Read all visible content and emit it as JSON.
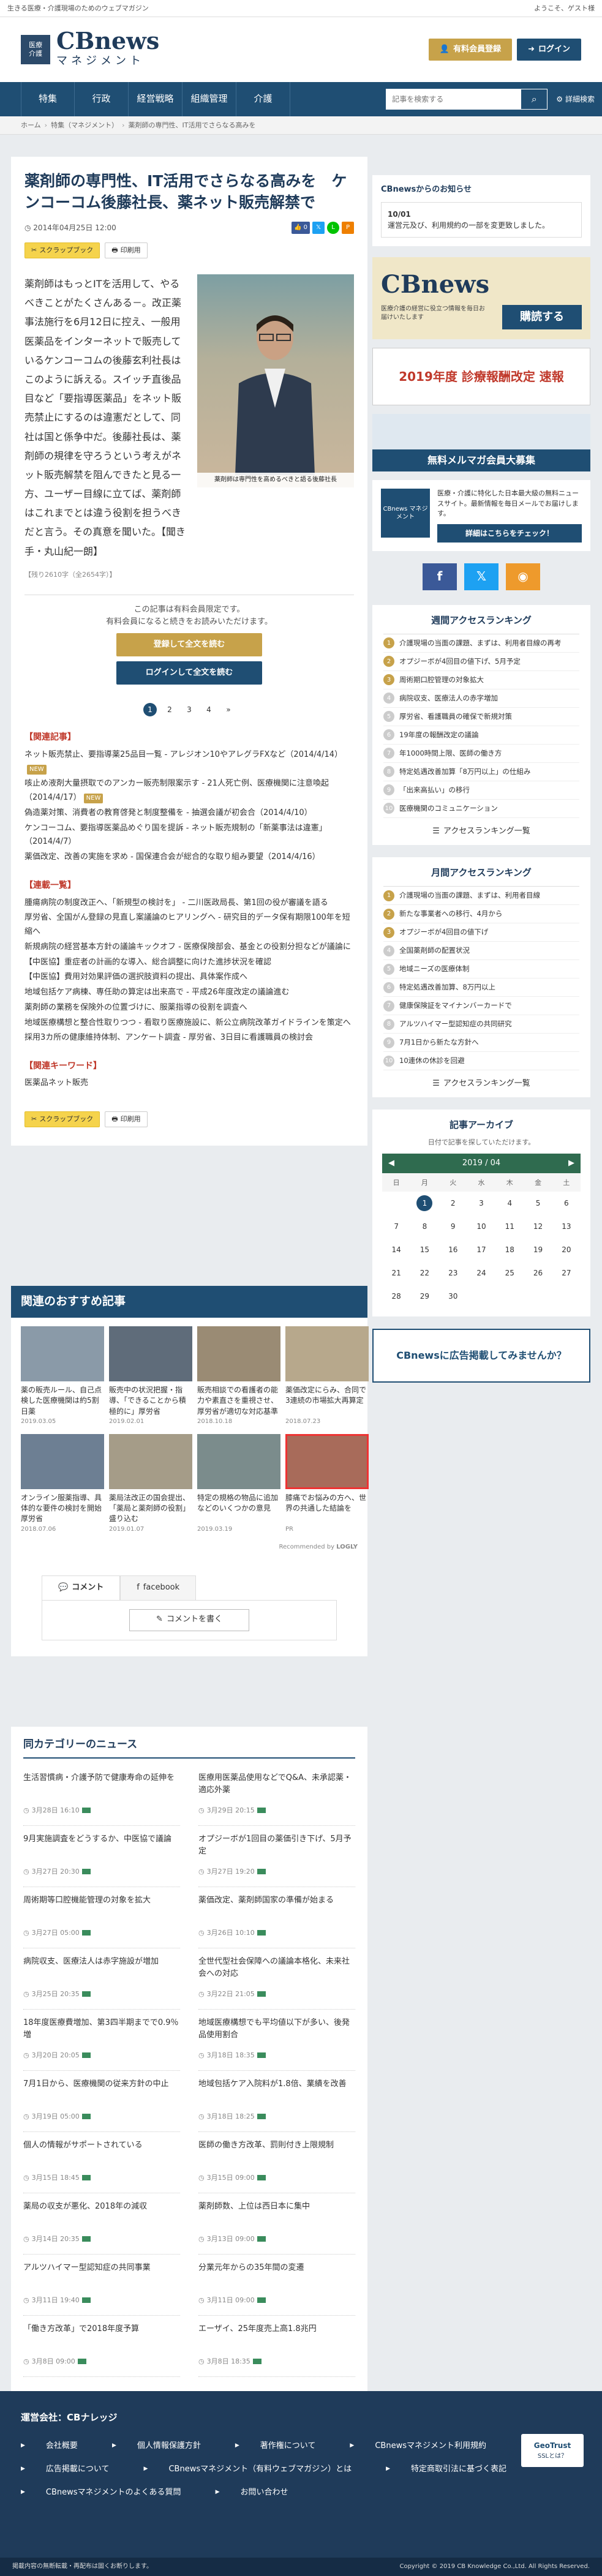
{
  "browser": {
    "url": "https://www.cbnews.jp/news/entry/42540",
    "tagline": "生きる医療・介護現場のためのウェブマガジン",
    "welcome": "ようこそ、ゲスト様"
  },
  "header": {
    "logo_badge_top": "医療",
    "logo_badge_bottom": "介護",
    "logo_name": "CBnews",
    "logo_sub": "マネジメント",
    "register_label": "有料会員登録",
    "login_label": "ログイン"
  },
  "nav": {
    "items": [
      "特集",
      "行政",
      "経営戦略",
      "組織管理",
      "介護"
    ],
    "search_placeholder": "記事を検索する",
    "advanced_label": "詳細検索"
  },
  "breadcrumb": [
    "ホーム",
    "特集（マネジメント）",
    "薬剤師の専門性、IT活用でさらなる高みを"
  ],
  "article": {
    "title": "薬剤師の専門性、IT活用でさらなる高みを　ケンコーコム後藤社長、薬ネット販売解禁で",
    "date": "2014年04月25日 12:00",
    "scrap_label": "スクラップブック",
    "print_label": "印刷用",
    "body": "薬剤師はもっとITを活用して、やるべきことがたくさんある－。改正薬事法施行を6月12日に控え、一般用医薬品をインターネットで販売しているケンコーコムの後藤玄利社長はこのように訴える。スイッチ直後品目など「要指導医薬品」をネット販売禁止にするのは違憲だとして、同社は国と係争中だ。後藤社長は、薬剤師の規律を守ろうという考えがネット販売解禁を阻んできたと見る一方、ユーザー目線に立てば、薬剤師はこれまでとは違う役割を担うべきだと言う。その真意を聞いた。【聞き手・丸山紀一朗】",
    "photo_caption": "薬剤師は専門性を高めるべきと語る後藤社長",
    "counts_note": "【残り2610字（全2654字）】",
    "pay_line1": "この記事は有料会員限定です。",
    "pay_line2": "有料会員になると続きをお読みいただけます。",
    "pay_btn1": "登録して全文を読む",
    "pay_btn2": "ログインして全文を読む",
    "pages": [
      "1",
      "2",
      "3",
      "4",
      "»"
    ],
    "related_title": "【関連記事】",
    "related": [
      {
        "text": "ネット販売禁止、要指導薬25品目一覧 - アレジオン10やアレグラFXなど（2014/4/14）",
        "new": true
      },
      {
        "text": "咳止め液剤大量摂取でのアンカー販売制限案示す - 21人死亡例、医療機関に注意喚起（2014/4/17）",
        "new": true
      },
      {
        "text": "偽造薬対策、消費者の教育啓発と制度整備を - 抽選会議が初会合（2014/4/10）",
        "new": false
      },
      {
        "text": "ケンコーコム、要指導医薬品めぐり国を提訴 - ネット販売規制の「新薬事法は違憲」（2014/4/7）",
        "new": false
      },
      {
        "text": "薬価改定、改善の実施を求め - 国保連合会が総合的な取り組み要望（2014/4/16）",
        "new": false
      }
    ],
    "list_title": "【連載一覧】",
    "list": [
      "腫瘍病院の制度改正へ、「新規型の検討を」 - 二川医政局長、第1回の役が審議を語る",
      "厚労省、全国がん登録の見直し案議論のヒアリングへ - 研究目的データ保有期限100年を短縮へ",
      "新規病院の経営基本方針の議論キックオフ - 医療保険部会、基金との役割分担などが議論に",
      "【中医協】重症者の計画的な導入、総合調整に向けた進捗状況を確認",
      "【中医協】費用対効果評価の選択肢資料の提出、具体案作成へ",
      "地域包括ケア病棟、専任助の算定は出来高で - 平成26年度改定の議論進む",
      "薬剤師の業務を保険外の位置づけに、服薬指導の役割を調査へ",
      "地域医療構想と整合性取りつつ - 看取り医療施設に、新公立病院改革ガイドラインを策定へ",
      "採用3カ所の健康維持体制、アンケート調査 - 厚労省、3日目に看護職員の検討会"
    ],
    "keyword_title": "【関連キーワード】",
    "keyword": "医薬品ネット販売"
  },
  "recommend": {
    "title": "関連のおすすめ記事",
    "cards": [
      {
        "caption": "薬の販売ルール、自己点検した医療機関は約5割 日薬",
        "date": "2019.03.05"
      },
      {
        "caption": "販売中の状況把握・指導、「できることから積極的に」厚労省",
        "date": "2019.02.01"
      },
      {
        "caption": "販売相談での看護者の能力や素直さを重視させ、厚労省が適切な対応基準",
        "date": "2018.10.18"
      },
      {
        "caption": "薬価改定にらみ、合同で3連続の市場拡大再算定",
        "date": "2018.07.23"
      },
      {
        "caption": "オンライン服薬指導、具体的な要件の検討を開始 厚労省",
        "date": "2018.07.06"
      },
      {
        "caption": "薬局法改正の国会提出、「薬局と薬剤師の役割」盛り込む",
        "date": "2019.01.07"
      },
      {
        "caption": "特定の規格の物品に追加などのいくつかの意見",
        "date": "2019.03.19"
      },
      {
        "caption": "膝痛でお悩みの方へ、世界の共通した結論を",
        "date": "PR"
      }
    ],
    "powered": "Recommended by",
    "powered_brand": "LOGLY"
  },
  "comments": {
    "tab_comment": "コメント",
    "tab_facebook": "facebook",
    "write_label": "コメントを書く"
  },
  "same_category": {
    "title": "同カテゴリーのニュース",
    "items": [
      {
        "title": "生活習慣病・介護予防で健康寿命の延伸を",
        "date": "3月28日 16:10"
      },
      {
        "title": "医療用医薬品使用などでQ&A、未承認薬・適応外薬",
        "date": "3月29日 20:15"
      },
      {
        "title": "9月実施調査をどうするか、中医協で議論",
        "date": "3月27日 20:30"
      },
      {
        "title": "オプジーボが1回目の薬価引き下げ、5月予定",
        "date": "3月27日 19:20"
      },
      {
        "title": "周術期等口腔機能管理の対象を拡大",
        "date": "3月27日 05:00"
      },
      {
        "title": "薬価改定、薬剤師国家の準備が始まる",
        "date": "3月26日 10:10"
      },
      {
        "title": "病院収支、医療法人は赤字施設が増加",
        "date": "3月25日 20:35"
      },
      {
        "title": "全世代型社会保障への議論本格化、未来社会への対応",
        "date": "3月22日 21:05"
      },
      {
        "title": "18年度医療費増加、第3四半期までで0.9％増",
        "date": "3月20日 20:05"
      },
      {
        "title": "地域医療構想でも平均値以下が多い、後発品使用割合",
        "date": "3月18日 18:35"
      },
      {
        "title": "7月1日から、医療機関の従来方針の中止",
        "date": "3月19日 05:00"
      },
      {
        "title": "地域包括ケア入院料が1.8倍、業績を改善",
        "date": "3月18日 18:25"
      },
      {
        "title": "個人の情報がサポートされている",
        "date": "3月15日 18:45"
      },
      {
        "title": "医師の働き方改革、罰則付き上限規制",
        "date": "3月15日 09:00"
      },
      {
        "title": "薬局の収支が悪化、2018年の減収",
        "date": "3月14日 20:35"
      },
      {
        "title": "薬剤師数、上位は西日本に集中",
        "date": "3月13日 09:00"
      },
      {
        "title": "アルツハイマー型認知症の共同事業",
        "date": "3月11日 19:40"
      },
      {
        "title": "分業元年からの35年間の変遷",
        "date": "3月11日 09:00"
      },
      {
        "title": "「働き方改革」で2018年度予算",
        "date": "3月8日 09:00"
      },
      {
        "title": "エーザイ、25年度売上高1.8兆円",
        "date": "3月8日 18:35"
      }
    ]
  },
  "sidebar": {
    "notice_title": "CBnewsからのお知らせ",
    "notice_date": "10/01",
    "notice_text": "運営元及び、利用規約の一部を変更致しました。",
    "banner1_text": "購読する",
    "banner1_caption": "医療介護の経営に役立つ情報を毎日お届けいたします",
    "banner2_text": "2019年度 診療報酬改定 速報",
    "banner3_text": "無料メルマガ会員大募集",
    "mm_logo": "CBnews マネジメント",
    "mm_text": "医療・介護に特化した日本最大級の無料ニュースサイト。最新情報を毎日メールでお届けします。",
    "mm_btn": "詳細はこちらをチェック！",
    "weekly_title": "週間アクセスランキング",
    "weekly": [
      "介護現場の当面の課題、まずは、利用者目線の再考",
      "オプジーボが4回目の値下げ、5月予定",
      "周術期口腔管理の対象拡大",
      "病院収支、医療法人の赤字増加",
      "厚労省、看護職員の確保で新規対策",
      "19年度の報酬改定の議論",
      "年1000時間上限、医師の働き方",
      "特定処遇改善加算「8万円以上」の仕組み",
      "「出来高払い」の移行",
      "医療機関のコミュニケーション"
    ],
    "weekly_more": "アクセスランキング一覧",
    "monthly_title": "月間アクセスランキング",
    "monthly": [
      "介護現場の当面の課題、まずは、利用者目線",
      "新たな事業者への移行、4月から",
      "オプジーボが4回目の値下げ",
      "全国薬剤師の配置状況",
      "地域ニーズの医療体制",
      "特定処遇改善加算、8万円以上",
      "健康保険証をマイナンバーカードで",
      "アルツハイマー型認知症の共同研究",
      "7月1日から新たな方針へ",
      "10連休の休診を回避"
    ],
    "monthly_more": "アクセスランキング一覧",
    "archive_title": "記事アーカイブ",
    "archive_note": "日付で記事を探していただけます。",
    "month": "2019 / 04",
    "dow": [
      "日",
      "月",
      "火",
      "水",
      "木",
      "金",
      "土"
    ],
    "days": [
      "",
      "1",
      "2",
      "3",
      "4",
      "5",
      "6",
      "7",
      "8",
      "9",
      "10",
      "11",
      "12",
      "13",
      "14",
      "15",
      "16",
      "17",
      "18",
      "19",
      "20",
      "21",
      "22",
      "23",
      "24",
      "25",
      "26",
      "27",
      "28",
      "29",
      "30",
      "",
      "",
      "",
      ""
    ],
    "ad_text": "CBnewsに広告掲載してみませんか？"
  },
  "footer": {
    "company_label": "運営会社：CBナレッジ",
    "links": [
      "会社概要",
      "個人情報保護方針",
      "著作権について",
      "CBnewsマネジメント利用規約",
      "広告掲載について",
      "CBnewsマネジメント（有料ウェブマガジン）とは",
      "特定商取引法に基づく表記",
      "CBnewsマネジメントのよくある質問",
      "お問い合わせ"
    ],
    "badge_title": "GeoTrust",
    "badge_sub": "SSLとは？",
    "note": "掲載内容の無断転載・再配布は固くお断りします。",
    "copyright": "Copyright © 2019 CB Knowledge Co.,Ltd. All Rights Reserved."
  }
}
